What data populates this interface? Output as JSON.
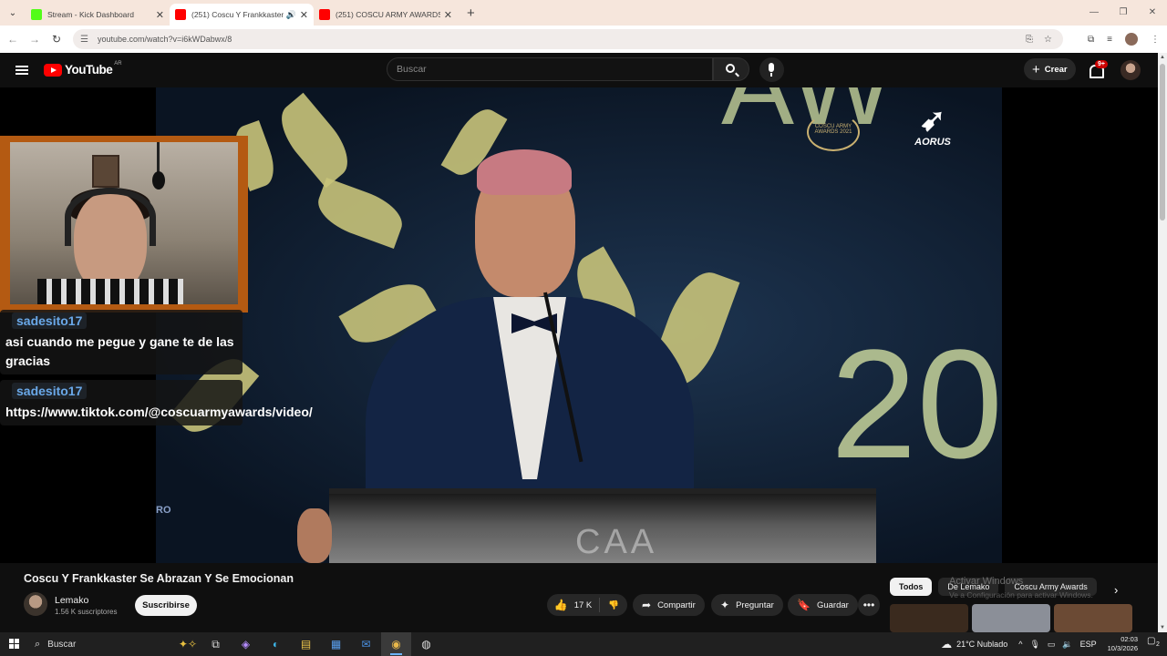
{
  "browser": {
    "tabs": [
      {
        "title": "Stream - Kick Dashboard",
        "icon": "kick-icon",
        "color": "#53fc18"
      },
      {
        "title": "(251) Coscu Y Frankkaster S",
        "icon": "youtube-icon",
        "color": "#ff0000",
        "active": true,
        "audio": true
      },
      {
        "title": "(251) COSCU ARMY AWARDS 2",
        "icon": "youtube-icon",
        "color": "#ff0000"
      }
    ],
    "new_tab": "+",
    "url": "youtube.com/watch?v=i6kWDabwx/8"
  },
  "youtube": {
    "logo_text": "YouTube",
    "region": "AR",
    "search_placeholder": "Buscar",
    "create_label": "Crear",
    "notif_badge": "9+"
  },
  "video": {
    "overlay_emblem": "COSCU ARMY AWARDS 2021",
    "sponsor": "AORUS",
    "big_text": "20",
    "corner_text": "RO",
    "podium_text": "CAA"
  },
  "chat": [
    {
      "user": "sadesito17",
      "message": "asi cuando me pegue y gane te de las gracias"
    },
    {
      "user": "sadesito17",
      "message": "https://www.tiktok.com/@coscuarmyawards/video/"
    }
  ],
  "info": {
    "title": "Coscu Y Frankkaster Se Abrazan Y Se Emocionan",
    "channel": "Lemako",
    "subscribers": "1.56 K suscriptores",
    "subscribe_label": "Suscribirse",
    "likes": "17 K",
    "share_label": "Compartir",
    "ask_label": "Preguntar",
    "save_label": "Guardar"
  },
  "recommend": {
    "chips": [
      "Todos",
      "De Lemako",
      "Coscu Army Awards"
    ],
    "watermark_title": "Activar Windows",
    "watermark_sub": "Ve a Configuración para activar Windows."
  },
  "taskbar": {
    "search_placeholder": "Buscar",
    "weather": "21°C  Nublado",
    "lang": "ESP",
    "time": "02:03",
    "date": "10/3/2026",
    "notif_count": "2"
  },
  "colors": {
    "yt_red": "#ff0000",
    "webcam_border": "#b45a12",
    "chat_username": "#6aa8e8"
  }
}
